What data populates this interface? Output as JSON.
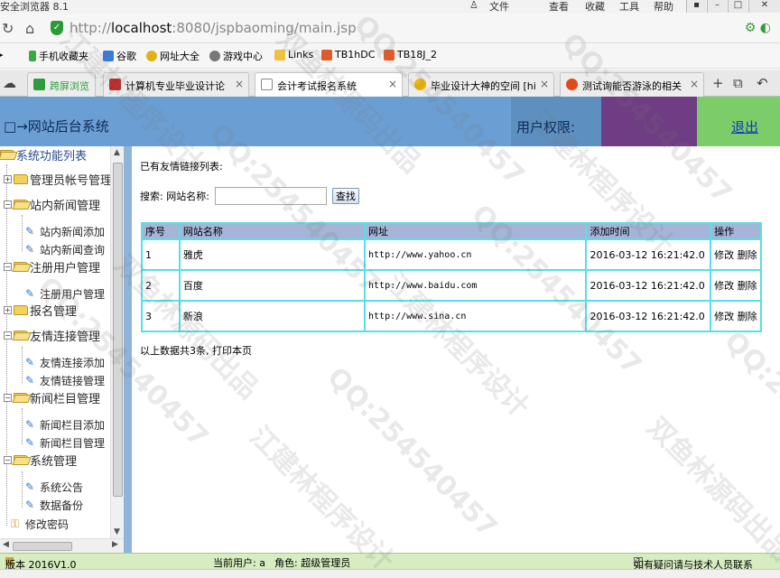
{
  "browser": {
    "title": "安全浏览器 8.1",
    "menus": [
      "文件",
      "查看",
      "收藏",
      "工具",
      "帮助"
    ],
    "url_scheme": "http://",
    "url_host": "localhost",
    "url_rest": ":8080/jspbaoming/main.jsp",
    "bookmarks": [
      {
        "label": "手机收藏夹",
        "color": "#3aa845"
      },
      {
        "label": "谷歌",
        "color": "#3a7ad9"
      },
      {
        "label": "网址大全",
        "color": "#e2b11a"
      },
      {
        "label": "游戏中心",
        "color": "#777777"
      },
      {
        "label": "Links",
        "color": "#f0c040"
      },
      {
        "label": "TB1hDC",
        "color": "#e05a2a"
      },
      {
        "label": "TB18J_2",
        "color": "#e05a2a"
      }
    ],
    "tabs": [
      {
        "label": "跨屏浏览",
        "color": "#2e9c3e"
      },
      {
        "label": "计算机专业毕业设计论",
        "color": "#c0282a"
      },
      {
        "label": "会计考试报名系统",
        "color": "#6a6a6a"
      },
      {
        "label": "毕业设计大神的空间 [hi",
        "color": "#f0b800"
      },
      {
        "label": "测试询能否游泳的相关",
        "color": "#e04a1a"
      }
    ]
  },
  "app": {
    "title": "□→网站后台系统",
    "permission_label": "用户权限:",
    "logout": "退出"
  },
  "sidebar": {
    "root": "系统功能列表",
    "groups": {
      "admin": "管理员帐号管理",
      "news": "站内新闻管理",
      "news_add": "站内新闻添加",
      "news_query": "站内新闻查询",
      "users": "注册用户管理",
      "users_manage": "注册用户管理",
      "signup": "报名管理",
      "links": "友情连接管理",
      "links_add": "友情连接添加",
      "links_manage": "友情链接管理",
      "columns": "新闻栏目管理",
      "columns_add": "新闻栏目添加",
      "columns_manage": "新闻栏目管理",
      "system": "系统管理",
      "system_notice": "系统公告",
      "system_backup": "数据备份",
      "password": "修改密码"
    }
  },
  "main": {
    "list_title": "已有友情链接列表:",
    "search_label": "搜索: 网站名称:",
    "search_value": "",
    "search_button": "查找",
    "columns": [
      "序号",
      "网站名称",
      "网址",
      "添加时间",
      "操作"
    ],
    "rows": [
      {
        "id": "1",
        "name": "雅虎",
        "url": "http://www.yahoo.cn",
        "time": "2016-03-12 16:21:42.0"
      },
      {
        "id": "2",
        "name": "百度",
        "url": "http://www.baidu.com",
        "time": "2016-03-12 16:21:42.0"
      },
      {
        "id": "3",
        "name": "新浪",
        "url": "http://www.sina.cn",
        "time": "2016-03-12 16:21:42.0"
      }
    ],
    "edit_label": "修改",
    "delete_label": "删除",
    "summary": "以上数据共3条, 打印本页"
  },
  "status": {
    "version": "版本 2016V1.0",
    "current_user": "当前用户: a",
    "role": "角色: 超级管理员",
    "help": "如有疑问请与技术人员联系"
  },
  "watermark": {
    "qq": "QQ:254540457",
    "cn1": "江建林程序设计",
    "cn2": "双鱼林源码出品"
  }
}
